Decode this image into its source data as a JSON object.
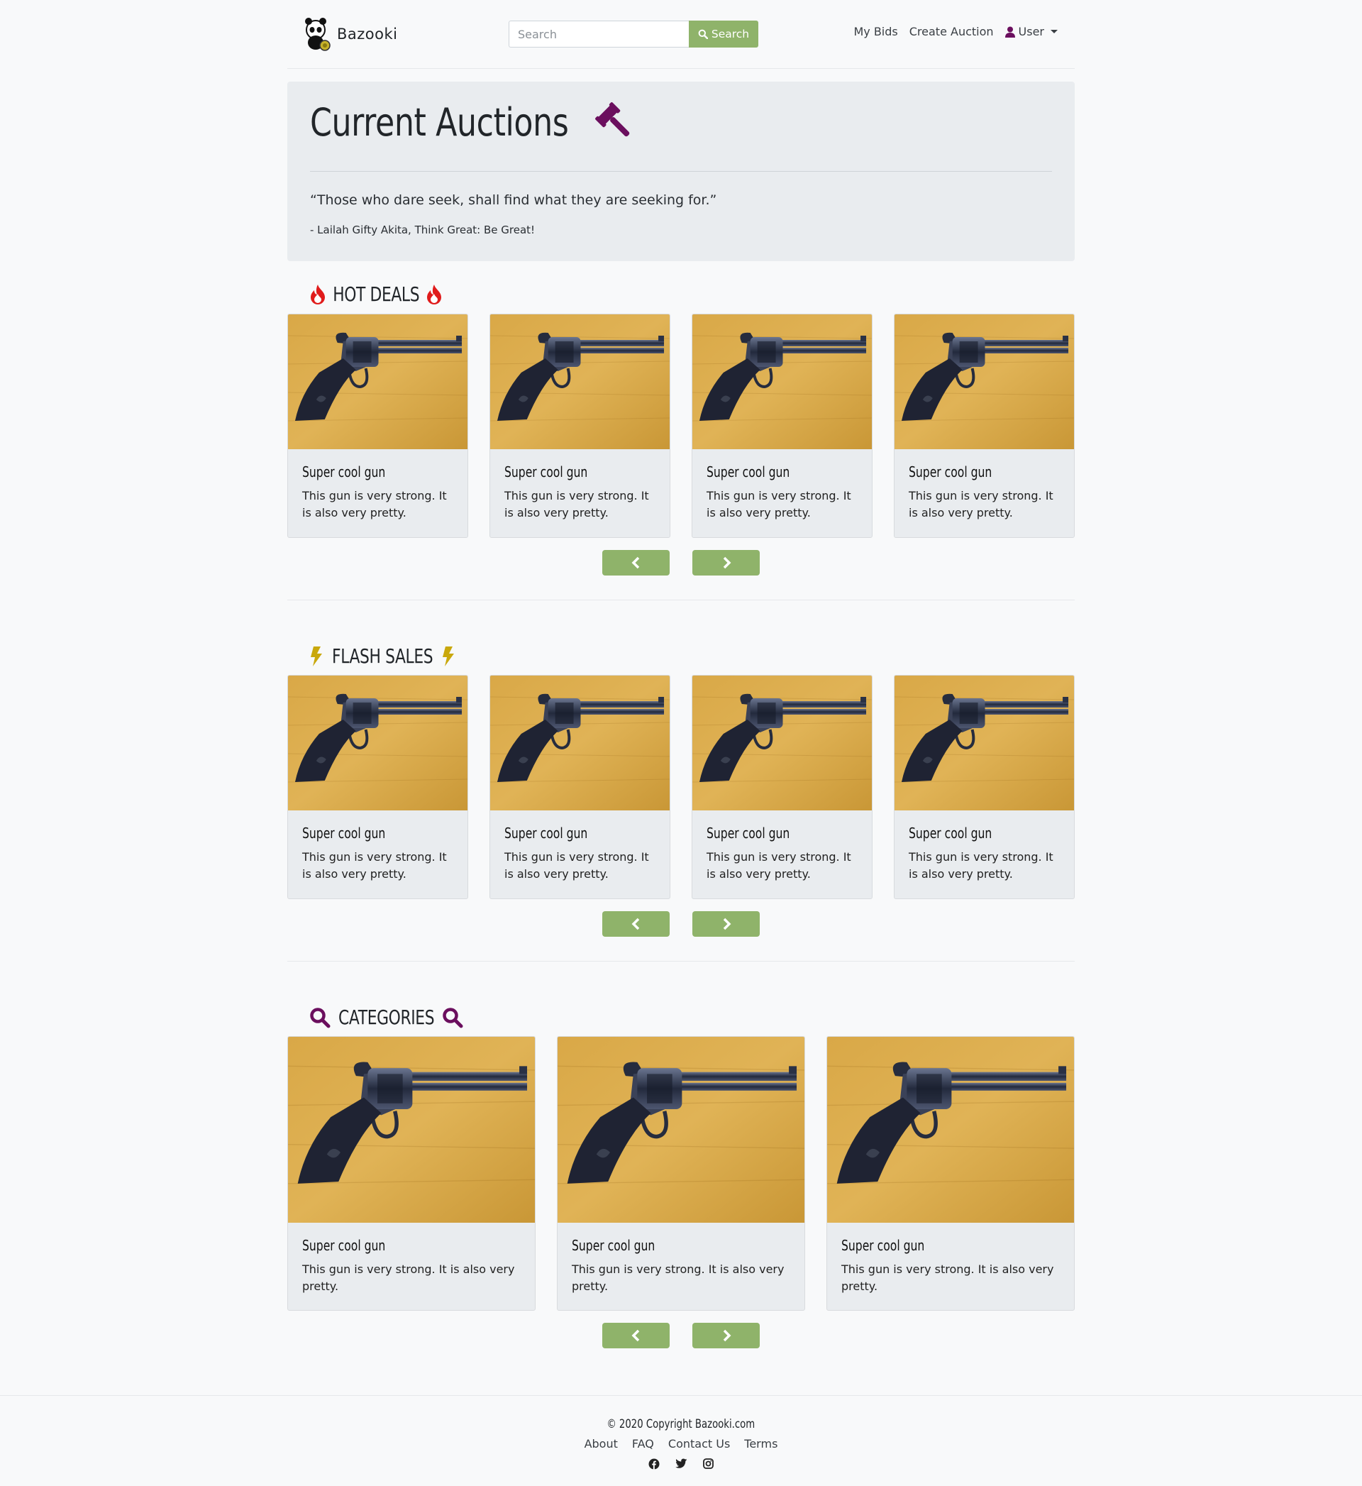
{
  "navbar": {
    "brand": "Bazooki",
    "search_placeholder": "Search",
    "search_button": "Search",
    "links": [
      "My Bids",
      "Create Auction"
    ],
    "user_label": "User"
  },
  "jumbotron": {
    "title": "Current Auctions",
    "quote": "“Those who dare seek, shall find what they are seeking for.”",
    "author": "- Lailah Gifty Akita, Think Great: Be Great!"
  },
  "sections": {
    "hot_deals": {
      "title": "HOT DEALS",
      "cards": [
        {
          "title": "Super cool gun",
          "text": "This gun is very strong. It is also very pretty."
        },
        {
          "title": "Super cool gun",
          "text": "This gun is very strong. It is also very pretty."
        },
        {
          "title": "Super cool gun",
          "text": "This gun is very strong. It is also very pretty."
        },
        {
          "title": "Super cool gun",
          "text": "This gun is very strong. It is also very pretty."
        }
      ]
    },
    "flash_sales": {
      "title": "FLASH SALES",
      "cards": [
        {
          "title": "Super cool gun",
          "text": "This gun is very strong. It is also very pretty."
        },
        {
          "title": "Super cool gun",
          "text": "This gun is very strong. It is also very pretty."
        },
        {
          "title": "Super cool gun",
          "text": "This gun is very strong. It is also very pretty."
        },
        {
          "title": "Super cool gun",
          "text": "This gun is very strong. It is also very pretty."
        }
      ]
    },
    "categories": {
      "title": "CATEGORIES",
      "cards": [
        {
          "title": "Super cool gun",
          "text": "This gun is very strong. It is also very pretty."
        },
        {
          "title": "Super cool gun",
          "text": "This gun is very strong. It is also very pretty."
        },
        {
          "title": "Super cool gun",
          "text": "This gun is very strong. It is also very pretty."
        }
      ]
    }
  },
  "footer": {
    "copyright": "© 2020 Copyright Bazooki.com",
    "links": [
      "About",
      "FAQ",
      "Contact Us",
      "Terms"
    ],
    "social_icons": [
      "facebook-icon",
      "twitter-icon",
      "instagram-icon"
    ]
  },
  "colors": {
    "accent_green": "#8fb36a",
    "brand_purple": "#6b0f5e",
    "fire_red": "#e01b1b",
    "bolt_yellow": "#c9a80c"
  }
}
